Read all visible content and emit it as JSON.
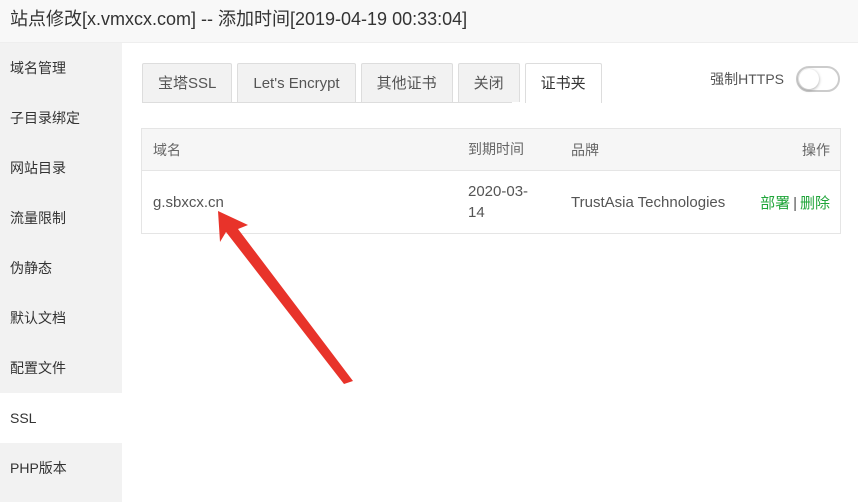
{
  "window": {
    "title": "站点修改[x.vmxcx.com] -- 添加时间[2019-04-19 00:33:04]"
  },
  "sidebar": {
    "items": [
      {
        "label": "域名管理"
      },
      {
        "label": "子目录绑定"
      },
      {
        "label": "网站目录"
      },
      {
        "label": "流量限制"
      },
      {
        "label": "伪静态"
      },
      {
        "label": "默认文档"
      },
      {
        "label": "配置文件"
      },
      {
        "label": "SSL",
        "active": true
      },
      {
        "label": "PHP版本"
      }
    ]
  },
  "tabs": [
    {
      "label": "宝塔SSL"
    },
    {
      "label": "Let's Encrypt"
    },
    {
      "label": "其他证书"
    },
    {
      "label": "关闭"
    },
    {
      "label": "证书夹",
      "active": true
    }
  ],
  "https_toggle": {
    "label": "强制HTTPS",
    "enabled": false
  },
  "table": {
    "headers": {
      "domain": "域名",
      "expiry": "到期时间",
      "brand": "品牌",
      "actions": "操作"
    },
    "rows": [
      {
        "domain": "g.sbxcx.cn",
        "expiry": "2020-03-14",
        "expiry_line1": "2020-03-",
        "expiry_line2": "14",
        "brand": "TrustAsia Technologies",
        "action_deploy": "部署",
        "action_sep": "|",
        "action_delete": "删除"
      }
    ]
  },
  "colors": {
    "accent_green": "#20a53a",
    "annotation_red": "#e8332a"
  }
}
